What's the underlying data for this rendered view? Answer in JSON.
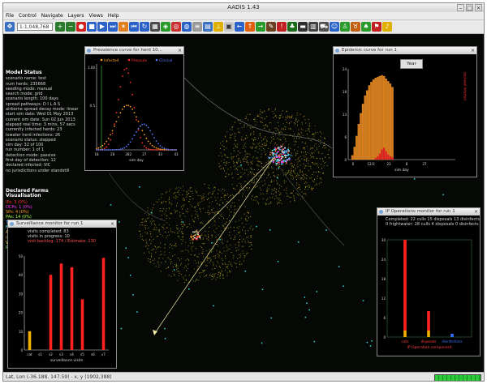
{
  "window": {
    "title": "AADIS 1.43"
  },
  "menu": [
    "File",
    "Control",
    "Navigate",
    "Layers",
    "Views",
    "Help"
  ],
  "toolbar": {
    "zoom_value": "1:1,048,768"
  },
  "model_status": {
    "header": "Model Status",
    "lines": [
      "scenario name: test",
      "num herds: 235668",
      "seeding mode: manual",
      "search mode: grid",
      "scenario length: 100 days",
      "spread pathways: D I L A S",
      "airborne spread decay mode: linear",
      "start sim date: Wed 01 May 2013",
      "current sim date: Sun 02 Jun 2013",
      "elapsed real time: 3 mins, 57 secs",
      "currently infected herds: 23",
      "lowater herd infections: 26",
      "scenario status: stepped",
      "sim day: 32 of 100",
      "run number: 1 of 1",
      "detection mode: passive",
      "first day of detection: 12",
      "declared infected: VIC",
      "no jurisdictions under standstill"
    ]
  },
  "declared_farms": {
    "header": "Declared Farms Visualisation",
    "rows": [
      {
        "label": "IPs:",
        "value": "3 (0%)",
        "color": "#ff3030"
      },
      {
        "label": "DCPs:",
        "value": "1 (0%)",
        "color": "#ff3cff"
      },
      {
        "label": "SPs:",
        "value": "4 (0%)",
        "color": "#ffa020"
      },
      {
        "label": "PAs:",
        "value": "14 (0%)",
        "color": "#a0ff40"
      },
      {
        "label": "TPs:",
        "value": "0 (0%)",
        "color": "#40a0ff"
      },
      {
        "label": "FIPs:",
        "value": "68 (1%)",
        "color": "#40ffff"
      },
      {
        "label": "ARPs:",
        "value": "407 (0%)",
        "color": "#ffc060"
      },
      {
        "label": "PORs:",
        "value": "1,122 (1%)",
        "color": "#c07020"
      },
      {
        "label": "VPs:",
        "value": "29 (0%)",
        "color": "#ffff40"
      },
      {
        "label": "RPs:",
        "value": "6 (0%)",
        "color": "#60ff60"
      }
    ]
  },
  "prevalence_panel": {
    "title": "Prevalence curve for herd 10...",
    "legend": [
      "Infected",
      "Preosule",
      "Clinical"
    ],
    "legend_colors": [
      "#ffa020",
      "#ff3030",
      "#5a78ff"
    ],
    "y_max_label": "1.00",
    "y_mid_label": "0.5",
    "x_ticks": [
      "18",
      "28",
      "282",
      "27",
      "33",
      "43"
    ],
    "xlabel": "sim day"
  },
  "epidemic_panel": {
    "title": "Epidemic curve for run 1",
    "button_label": "Year",
    "y_ticks": [
      "24",
      "18",
      "13",
      "6",
      "0"
    ],
    "x_ticks": [
      "0",
      "12/3",
      "23",
      "8",
      "27"
    ],
    "xlabel": "sim day",
    "right_legend": "declared infected",
    "heights": [
      0.05,
      0.15,
      0.28,
      0.42,
      0.55,
      0.66,
      0.76,
      0.82,
      0.88,
      0.92,
      0.95,
      0.97,
      0.98,
      0.99,
      1.0,
      0.99,
      0.96,
      0.93,
      0.9,
      0.86
    ],
    "red_heights": [
      0,
      0,
      0,
      0,
      0,
      0,
      0,
      0,
      0,
      0,
      0,
      0.02,
      0.04,
      0.07,
      0.12,
      0.14,
      0.1,
      0.06,
      0.04,
      0.03
    ]
  },
  "surveillance_panel": {
    "title": "Surveillance monitor for run 1",
    "lines": [
      "visits completed: 83",
      "visits in progress: 10",
      "visit backlog: 174 / Estimate: 130"
    ],
    "line_colors": [
      "#d6d6d6",
      "#d6d6d6",
      "#ff5050"
    ],
    "y_ticks": [
      "50",
      "40",
      "30",
      "20",
      "10",
      "0"
    ],
    "categories": [
      "cat",
      "s1",
      "s2",
      "s3",
      "s4",
      "s5",
      "s6",
      "s7"
    ],
    "values": [
      10,
      0,
      40,
      46,
      44,
      27,
      0,
      49
    ],
    "bar_colors": [
      "#f0b000",
      "#ff2020",
      "#ff2020",
      "#ff2020",
      "#ff2020",
      "#ff2020",
      "#ff2020",
      "#ff2020"
    ],
    "xlabel": "surveillance visits"
  },
  "ip_ops_panel": {
    "title": "IP Operations monitor for run 1",
    "line1": "Completed: 22 culls 15 disposals 13 disinfects",
    "line2": "0 frightwater: 28 culls 4 disposals 0 disinfects",
    "y_ticks": [
      "30",
      "24",
      "18",
      "12",
      "6",
      "0"
    ],
    "categories": [
      "culls",
      "disposals",
      "disinfections"
    ],
    "xlabel": "IP Operation component"
  },
  "status_bar": {
    "text": "Lat, Lon (-36.188, 147.59) - x, y (1902,388)"
  }
}
